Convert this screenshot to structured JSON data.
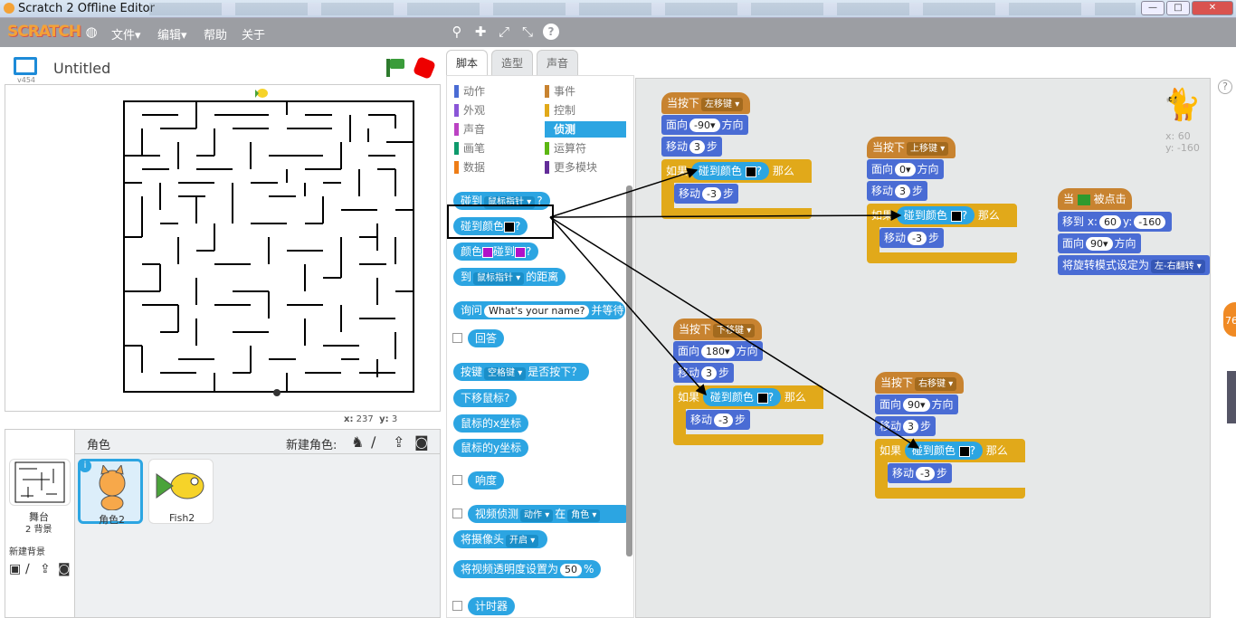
{
  "window": {
    "title": "Scratch 2 Offline Editor",
    "min": "—",
    "max": "□",
    "close": "✕"
  },
  "menubar": {
    "logo": "SCRATCH",
    "items": [
      "文件▾",
      "编辑▾",
      "帮助",
      "关于"
    ]
  },
  "stage": {
    "version": "v454",
    "project_title": "Untitled",
    "coords_x_label": "x:",
    "coords_x": "237",
    "coords_y_label": "y:",
    "coords_y": "3"
  },
  "sprites": {
    "title": "角色",
    "new_sprite_label": "新建角色:",
    "stage_label": "舞台",
    "backdrops": "2 背景",
    "new_backdrop_label": "新建背景",
    "list": [
      {
        "name": "角色2",
        "selected": true
      },
      {
        "name": "Fish2",
        "selected": false
      }
    ]
  },
  "tabs": [
    "脚本",
    "造型",
    "声音"
  ],
  "categories": [
    {
      "label": "动作",
      "color": "#4a6cd4"
    },
    {
      "label": "事件",
      "color": "#c88330"
    },
    {
      "label": "外观",
      "color": "#8a55d7"
    },
    {
      "label": "控制",
      "color": "#e1a91a"
    },
    {
      "label": "声音",
      "color": "#bb42c3"
    },
    {
      "label": "侦测",
      "color": "#2ca5e2",
      "selected": true
    },
    {
      "label": "画笔",
      "color": "#0e9a6c"
    },
    {
      "label": "运算符",
      "color": "#5cb712"
    },
    {
      "label": "数据",
      "color": "#ee7d16"
    },
    {
      "label": "更多模块",
      "color": "#632d99"
    }
  ],
  "palette": {
    "touching": "碰到",
    "mouse_pointer": "鼠标指针",
    "q": "?",
    "touching_color": "碰到颜色",
    "color_word": "颜色",
    "touching2": "碰到",
    "to": "到",
    "distance": "的距离",
    "ask": "询问",
    "ask_default": "What's your name?",
    "and_wait": "并等待",
    "answer": "回答",
    "key": "按键",
    "space_key": "空格键",
    "pressed": "是否按下？",
    "mouse_down": "下移鼠标?",
    "mouse_x": "鼠标的x坐标",
    "mouse_y": "鼠标的y坐标",
    "loudness": "响度",
    "video_detect": "视频侦测",
    "motion": "动作",
    "on": "在",
    "sprite": "角色",
    "turn_video": "将摄像头",
    "video_on": "开启",
    "set_transparency": "将视频透明度设置为",
    "transparency": "50",
    "percent": "%",
    "timer": "计时器"
  },
  "scripts": {
    "when_key": "当按下",
    "left_key": "左移键",
    "up_key": "上移键",
    "down_key": "下移键",
    "right_key": "右移键",
    "point_dir": "面向",
    "dir_word": "方向",
    "move": "移动",
    "steps": "步",
    "if_word": "如果",
    "then": "那么",
    "touching_color": "碰到颜色",
    "q": "?",
    "dir_left": "-90",
    "dir_up": "0",
    "dir_down": "180",
    "dir_right": "90",
    "step_fwd": "3",
    "step_back": "-3",
    "when_flag": "当",
    "clicked": "被点击",
    "goto": "移到 x:",
    "x_val": "60",
    "y_label": "y:",
    "y_val": "-160",
    "rotation": "将旋转模式设定为",
    "rotation_mode": "左-右翻转",
    "sprite_x": "x: 60",
    "sprite_y": "y: -160"
  },
  "bubble": "76"
}
